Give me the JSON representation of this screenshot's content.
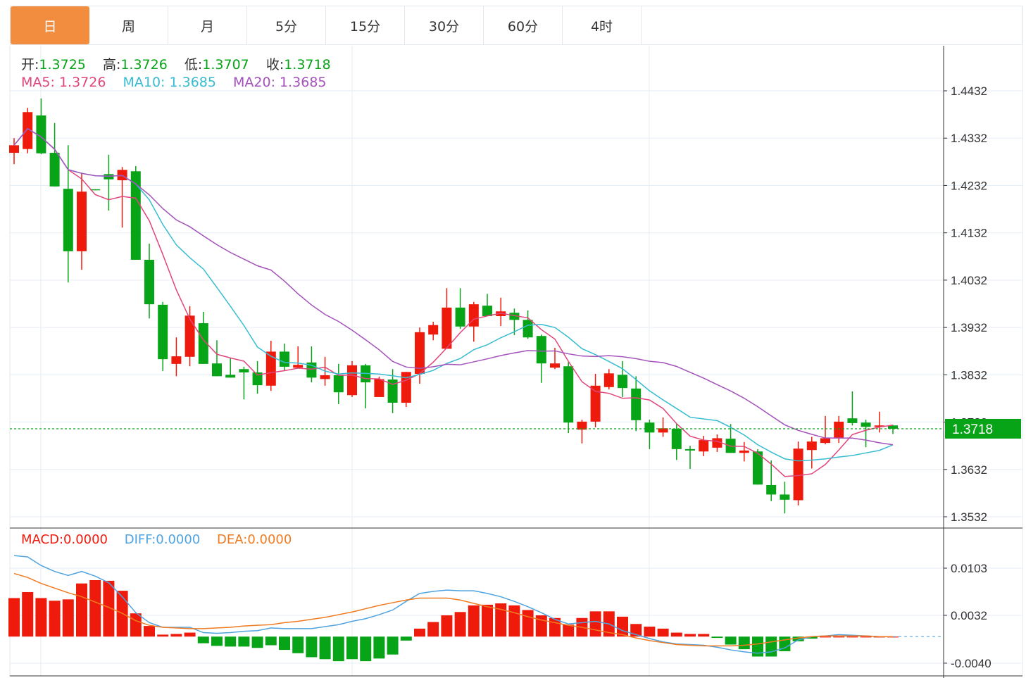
{
  "tabs": [
    "日",
    "周",
    "月",
    "5分",
    "15分",
    "30分",
    "60分",
    "4时"
  ],
  "active_tab": 0,
  "ohlc_info": {
    "open_label": "开:",
    "open": "1.3725",
    "high_label": "高:",
    "high": "1.3726",
    "low_label": "低:",
    "low": "1.3707",
    "close_label": "收:",
    "close": "1.3718"
  },
  "ma_info": {
    "ma5_label": "MA5:",
    "ma5": "1.3726",
    "ma10_label": "MA10:",
    "ma10": "1.3685",
    "ma20_label": "MA20:",
    "ma20": "1.3685"
  },
  "macd_info": {
    "macd_label": "MACD:",
    "macd": "0.0000",
    "diff_label": "DIFF:",
    "diff": "0.0000",
    "dea_label": "DEA:",
    "dea": "0.0000"
  },
  "current_price": "1.3718",
  "colors": {
    "up": "#EE1B0C",
    "down": "#08A418",
    "ma5": "#E0457B",
    "ma10": "#37BCD1",
    "ma20": "#A452BB",
    "diff": "#4FA3E0",
    "dea": "#F07A20",
    "tab_active": "#F28C3F",
    "label_text_label": "#333333"
  },
  "chart_data": [
    {
      "type": "candlestick",
      "title": "",
      "ylim": [
        1.3532,
        1.4432
      ],
      "y_ticks": [
        "1.4432",
        "1.4332",
        "1.4232",
        "1.4132",
        "1.4032",
        "1.3932",
        "1.3832",
        "1.3732",
        "1.3632",
        "1.3532"
      ],
      "ma_periods": [
        5,
        10,
        20
      ],
      "candles": [
        [
          1.4301,
          1.4317,
          1.4332,
          1.4277
        ],
        [
          1.4309,
          1.4387,
          1.4396,
          1.43
        ],
        [
          1.438,
          1.43,
          1.4416,
          1.4298
        ],
        [
          1.4301,
          1.423,
          1.4364,
          1.423
        ],
        [
          1.4225,
          1.4093,
          1.4317,
          1.4027
        ],
        [
          1.4093,
          1.4219,
          1.4259,
          1.4054
        ],
        [
          1.4224,
          1.4222,
          1.4224,
          1.4222
        ],
        [
          1.4256,
          1.4245,
          1.4297,
          1.4179
        ],
        [
          1.4243,
          1.4265,
          1.4271,
          1.4143
        ],
        [
          1.4262,
          1.4075,
          1.4273,
          1.4075
        ],
        [
          1.4075,
          1.3981,
          1.4109,
          1.3951
        ],
        [
          1.398,
          1.3865,
          1.3986,
          1.384
        ],
        [
          1.3855,
          1.3871,
          1.3911,
          1.3829
        ],
        [
          1.387,
          1.3957,
          1.3977,
          1.385
        ],
        [
          1.3941,
          1.3855,
          1.3965,
          1.3855
        ],
        [
          1.3856,
          1.3829,
          1.3905,
          1.3829
        ],
        [
          1.3832,
          1.3826,
          1.3868,
          1.3826
        ],
        [
          1.3844,
          1.3837,
          1.3849,
          1.378
        ],
        [
          1.3837,
          1.381,
          1.3861,
          1.3792
        ],
        [
          1.3809,
          1.3881,
          1.3904,
          1.3798
        ],
        [
          1.3881,
          1.3849,
          1.3898,
          1.384
        ],
        [
          1.3847,
          1.3853,
          1.3892,
          1.3846
        ],
        [
          1.3858,
          1.3826,
          1.3892,
          1.3816
        ],
        [
          1.3823,
          1.3831,
          1.387,
          1.3809
        ],
        [
          1.3831,
          1.3795,
          1.3855,
          1.377
        ],
        [
          1.3789,
          1.3852,
          1.3861,
          1.3785
        ],
        [
          1.3852,
          1.3816,
          1.3855,
          1.3761
        ],
        [
          1.3785,
          1.3823,
          1.3828,
          1.3785
        ],
        [
          1.3822,
          1.3773,
          1.3844,
          1.3751
        ],
        [
          1.3773,
          1.3838,
          1.3838,
          1.3764
        ],
        [
          1.3834,
          1.3922,
          1.3932,
          1.3813
        ],
        [
          1.3917,
          1.3937,
          1.3944,
          1.3905
        ],
        [
          1.3887,
          1.3974,
          1.4015,
          1.3887
        ],
        [
          1.3974,
          1.3934,
          1.4015,
          1.3929
        ],
        [
          1.3934,
          1.3981,
          1.3986,
          1.3902
        ],
        [
          1.3978,
          1.3956,
          1.4003,
          1.3956
        ],
        [
          1.3956,
          1.3966,
          1.3995,
          1.3935
        ],
        [
          1.3963,
          1.3948,
          1.3972,
          1.3916
        ],
        [
          1.3948,
          1.3911,
          1.3968,
          1.3908
        ],
        [
          1.3914,
          1.3856,
          1.3917,
          1.3815
        ],
        [
          1.3847,
          1.3856,
          1.3889,
          1.3844
        ],
        [
          1.385,
          1.3731,
          1.3859,
          1.3709
        ],
        [
          1.3716,
          1.3733,
          1.3737,
          1.3687
        ],
        [
          1.3733,
          1.3809,
          1.3834,
          1.3721
        ],
        [
          1.3806,
          1.3835,
          1.3844,
          1.3801
        ],
        [
          1.3832,
          1.3804,
          1.3861,
          1.3785
        ],
        [
          1.3803,
          1.3736,
          1.3829,
          1.3713
        ],
        [
          1.3731,
          1.371,
          1.3737,
          1.3675
        ],
        [
          1.371,
          1.3719,
          1.3742,
          1.3701
        ],
        [
          1.3718,
          1.3675,
          1.3728,
          1.3652
        ],
        [
          1.3675,
          1.3672,
          1.3682,
          1.3633
        ],
        [
          1.367,
          1.3694,
          1.3703,
          1.366
        ],
        [
          1.3678,
          1.3698,
          1.3706,
          1.3669
        ],
        [
          1.3697,
          1.3667,
          1.3728,
          1.3667
        ],
        [
          1.3667,
          1.3672,
          1.369,
          1.3649
        ],
        [
          1.367,
          1.36,
          1.3675,
          1.36
        ],
        [
          1.3599,
          1.3579,
          1.3651,
          1.3565
        ],
        [
          1.3579,
          1.3568,
          1.3606,
          1.3539
        ],
        [
          1.3567,
          1.3676,
          1.3691,
          1.3556
        ],
        [
          1.3673,
          1.3691,
          1.3701,
          1.3634
        ],
        [
          1.3688,
          1.3698,
          1.3745,
          1.3685
        ],
        [
          1.3698,
          1.3733,
          1.3745,
          1.3688
        ],
        [
          1.374,
          1.373,
          1.3797,
          1.3725
        ],
        [
          1.3731,
          1.3722,
          1.3737,
          1.3679
        ],
        [
          1.3722,
          1.3725,
          1.3754,
          1.371
        ],
        [
          1.3725,
          1.3718,
          1.3726,
          1.3707
        ]
      ]
    },
    {
      "type": "bar+line",
      "title": "MACD",
      "ylim": [
        -0.004,
        0.0103
      ],
      "y_ticks": [
        "0.0103",
        "0.0032",
        "-0.0040"
      ],
      "macd": [
        0.0058,
        0.0067,
        0.0058,
        0.0054,
        0.0056,
        0.008,
        0.0085,
        0.0084,
        0.0069,
        0.0035,
        0.0016,
        0.0003,
        0.0004,
        0.0006,
        -0.001,
        -0.0014,
        -0.0015,
        -0.0015,
        -0.0017,
        -0.0013,
        -0.002,
        -0.0025,
        -0.0031,
        -0.0034,
        -0.0037,
        -0.0034,
        -0.0037,
        -0.0033,
        -0.0027,
        -0.0006,
        0.0012,
        0.0022,
        0.0032,
        0.0037,
        0.0047,
        0.0048,
        0.005,
        0.0047,
        0.004,
        0.0032,
        0.0028,
        0.0018,
        0.0028,
        0.0038,
        0.0038,
        0.003,
        0.0019,
        0.0015,
        0.0012,
        0.0006,
        0.0004,
        0.0004,
        -0.0002,
        -0.0012,
        -0.0019,
        -0.003,
        -0.003,
        -0.0022,
        -0.0007,
        -0.0003,
        0,
        0,
        0,
        0,
        0,
        0
      ],
      "diff": [
        0.0122,
        0.012,
        0.0107,
        0.0098,
        0.0092,
        0.0098,
        0.0091,
        0.0081,
        0.006,
        0.0036,
        0.0021,
        0.0014,
        0.0014,
        0.0014,
        0.0006,
        0.0005,
        0.0006,
        0.0008,
        0.0009,
        0.0013,
        0.0012,
        0.0012,
        0.0012,
        0.0015,
        0.0018,
        0.0023,
        0.0027,
        0.0033,
        0.004,
        0.0053,
        0.0065,
        0.0068,
        0.007,
        0.0069,
        0.0069,
        0.0065,
        0.006,
        0.0053,
        0.0045,
        0.0036,
        0.0026,
        0.0019,
        0.0021,
        0.0023,
        0.0019,
        0.0009,
        0.0003,
        -0.0003,
        -0.0008,
        -0.0011,
        -0.0012,
        -0.0013,
        -0.0016,
        -0.002,
        -0.0023,
        -0.0025,
        -0.0023,
        -0.0017,
        -0.0005,
        0,
        0.0001,
        0.0003,
        0.0002,
        0.0001,
        0,
        0
      ],
      "dea": [
        0.0095,
        0.0089,
        0.008,
        0.0073,
        0.0066,
        0.006,
        0.0052,
        0.0044,
        0.0035,
        0.0024,
        0.0017,
        0.0014,
        0.0013,
        0.0012,
        0.0012,
        0.0013,
        0.0014,
        0.0016,
        0.0017,
        0.0018,
        0.0021,
        0.0023,
        0.0026,
        0.0029,
        0.0033,
        0.0037,
        0.0042,
        0.0047,
        0.0051,
        0.0055,
        0.0058,
        0.0058,
        0.0058,
        0.0055,
        0.005,
        0.0045,
        0.0041,
        0.0036,
        0.003,
        0.0025,
        0.0021,
        0.0017,
        0.0014,
        0.001,
        0.0006,
        0.0003,
        -0.0002,
        -0.0006,
        -0.0009,
        -0.0012,
        -0.0013,
        -0.0014,
        -0.0014,
        -0.0014,
        -0.0013,
        -0.0011,
        -0.0008,
        -0.0005,
        -0.0002,
        0,
        0.0001,
        0.0001,
        0.0001,
        0.0001,
        0,
        0
      ]
    }
  ]
}
